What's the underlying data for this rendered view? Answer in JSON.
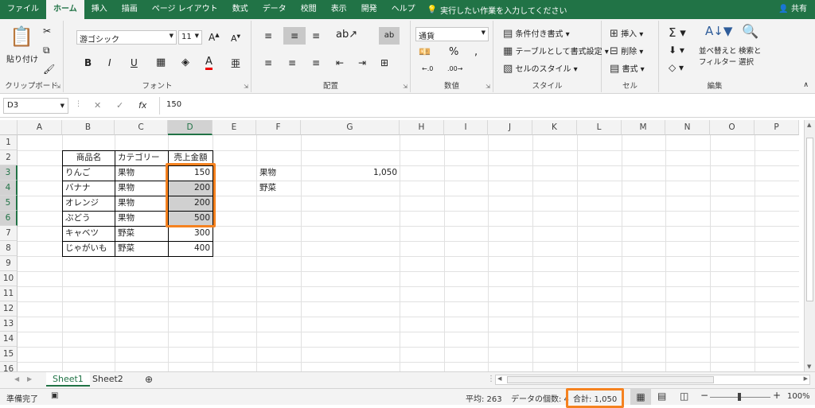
{
  "tabs": [
    "ファイル",
    "ホーム",
    "挿入",
    "描画",
    "ページ レイアウト",
    "数式",
    "データ",
    "校閲",
    "表示",
    "開発",
    "ヘルプ"
  ],
  "tell_me": "実行したい作業を入力してください",
  "share": "共有",
  "ribbon": {
    "clipboard": {
      "paste": "貼り付け",
      "label": "クリップボード"
    },
    "font": {
      "name": "游ゴシック",
      "size": "11",
      "label": "フォント"
    },
    "alignment": {
      "label": "配置"
    },
    "number": {
      "format": "通貨",
      "label": "数値"
    },
    "styles": {
      "conditional": "条件付き書式",
      "table": "テーブルとして書式設定",
      "cell_styles": "セルのスタイル",
      "label": "スタイル"
    },
    "cells": {
      "insert": "挿入",
      "delete": "削除",
      "format": "書式",
      "label": "セル"
    },
    "editing": {
      "sort_1": "並べ替えと",
      "sort_2": "フィルター",
      "find_1": "検索と",
      "find_2": "選択",
      "label": "編集"
    }
  },
  "formula_bar": {
    "name_box": "D3",
    "value": "150"
  },
  "columns": [
    "A",
    "B",
    "C",
    "D",
    "E",
    "F",
    "G",
    "H",
    "I",
    "J",
    "K",
    "L",
    "M",
    "N",
    "O",
    "P"
  ],
  "rows": [
    "1",
    "2",
    "3",
    "4",
    "5",
    "6",
    "7",
    "8",
    "9",
    "10",
    "11",
    "12",
    "13",
    "14",
    "15",
    "16"
  ],
  "table": {
    "headers": [
      "商品名",
      "カテゴリー",
      "売上金額"
    ],
    "rows": [
      [
        "りんご",
        "果物",
        "150"
      ],
      [
        "バナナ",
        "果物",
        "200"
      ],
      [
        "オレンジ",
        "果物",
        "200"
      ],
      [
        "ぶどう",
        "果物",
        "500"
      ],
      [
        "キャベツ",
        "野菜",
        "300"
      ],
      [
        "じゃがいも",
        "野菜",
        "400"
      ]
    ]
  },
  "side": {
    "f3": "果物",
    "g3": "1,050",
    "f4": "野菜"
  },
  "sheets": [
    "Sheet1",
    "Sheet2"
  ],
  "status": {
    "ready": "準備完了",
    "average": "平均: 263",
    "count": "データの個数: 4",
    "sum": "合計: 1,050",
    "zoom": "100%"
  },
  "accent": "#217346",
  "highlight": "#f58220"
}
